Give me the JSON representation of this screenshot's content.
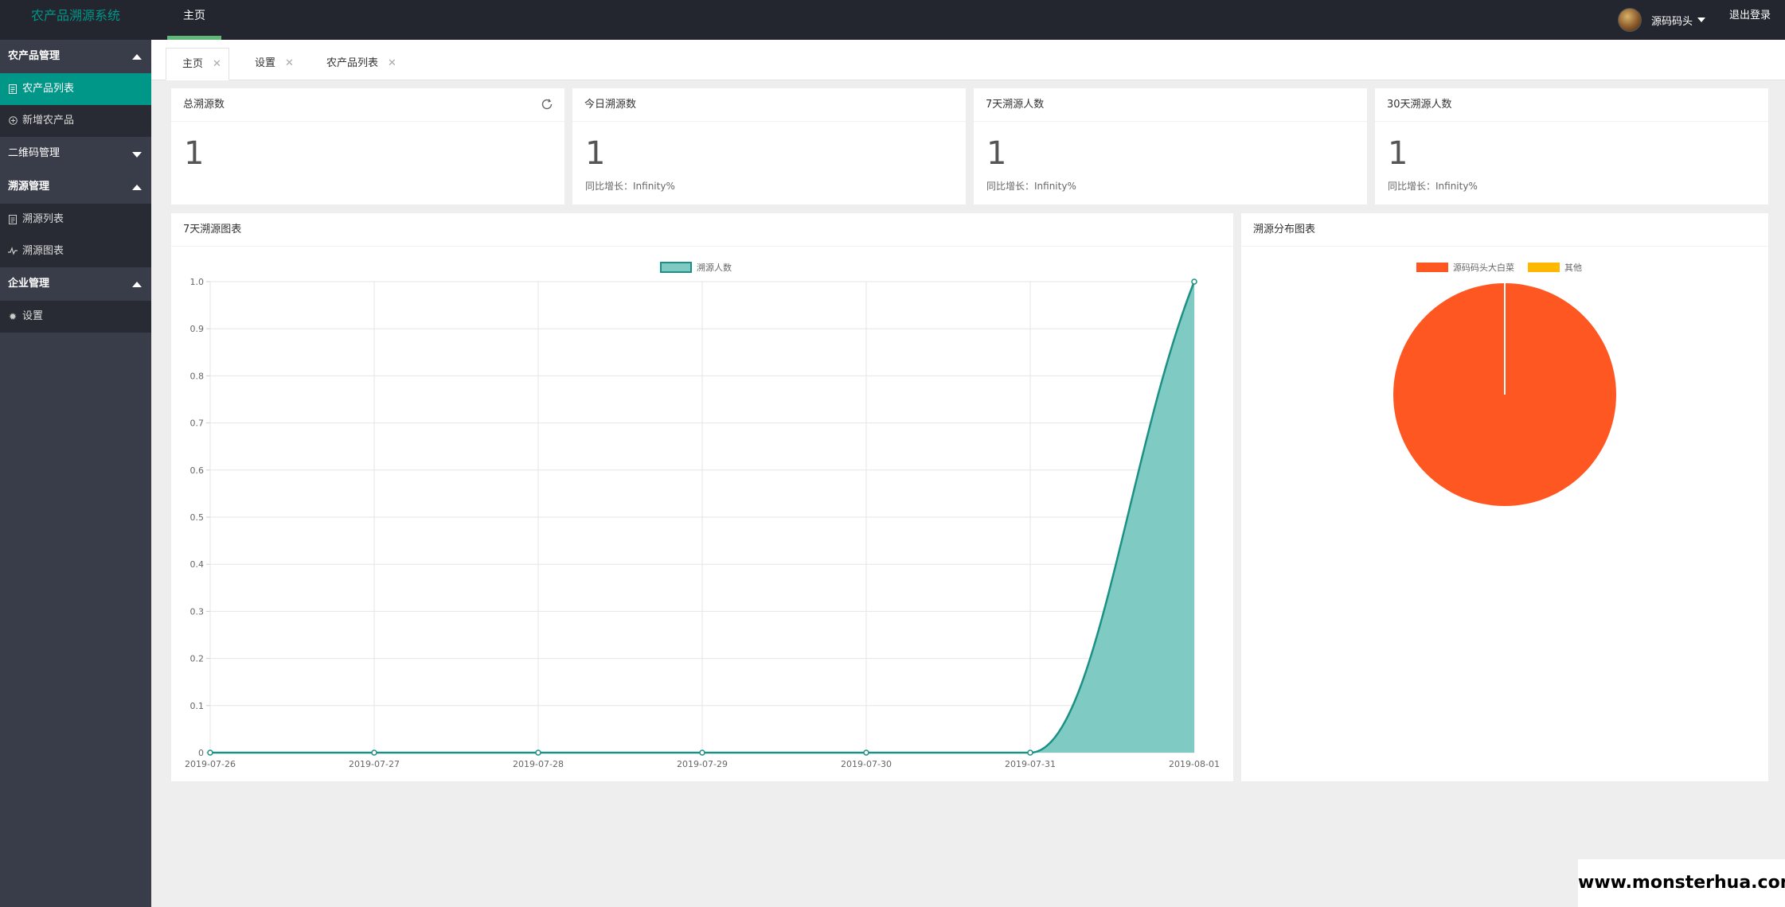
{
  "header": {
    "app_title": "农产品溯源系统",
    "nav_home": "主页",
    "username": "源码码头",
    "logout": "退出登录"
  },
  "sidebar": {
    "groups": [
      {
        "label": "农产品管理",
        "items": [
          "农产品列表",
          "新增农产品"
        ]
      },
      {
        "label": "二维码管理",
        "items": []
      },
      {
        "label": "溯源管理",
        "items": [
          "溯源列表",
          "溯源图表"
        ]
      },
      {
        "label": "企业管理",
        "items": [
          "设置"
        ]
      }
    ]
  },
  "tabs": [
    {
      "label": "主页"
    },
    {
      "label": "设置"
    },
    {
      "label": "农产品列表"
    }
  ],
  "stats": [
    {
      "title": "总溯源数",
      "value": "1",
      "sub": ""
    },
    {
      "title": "今日溯源数",
      "value": "1",
      "sub": "同比增长：Infinity%"
    },
    {
      "title": "7天溯源人数",
      "value": "1",
      "sub": "同比增长：Infinity%"
    },
    {
      "title": "30天溯源人数",
      "value": "1",
      "sub": "同比增长：Infinity%"
    }
  ],
  "line_panel": {
    "title": "7天溯源图表"
  },
  "pie_panel": {
    "title": "溯源分布图表"
  },
  "chart_data": [
    {
      "type": "area",
      "title": "",
      "x": [
        "2019-07-26",
        "2019-07-27",
        "2019-07-28",
        "2019-07-29",
        "2019-07-30",
        "2019-07-31",
        "2019-08-01"
      ],
      "series": [
        {
          "name": "溯源人数",
          "values": [
            0,
            0,
            0,
            0,
            0,
            0,
            1
          ]
        }
      ],
      "ylim": [
        0,
        1.0
      ],
      "yticks": [
        "0",
        "0.1",
        "0.2",
        "0.3",
        "0.4",
        "0.5",
        "0.6",
        "0.7",
        "0.8",
        "0.9",
        "1.0"
      ],
      "grid": true,
      "legend": "top-center",
      "colors": {
        "line": "#1a9184",
        "fill": "#7fcac2"
      }
    },
    {
      "type": "pie",
      "title": "",
      "labels": [
        "源码码头大白菜",
        "其他"
      ],
      "values": [
        1,
        0
      ],
      "legend": "top-center",
      "colors": [
        "#ff5722",
        "#ffb800"
      ]
    }
  ],
  "watermark": "www.monsterhua.com"
}
